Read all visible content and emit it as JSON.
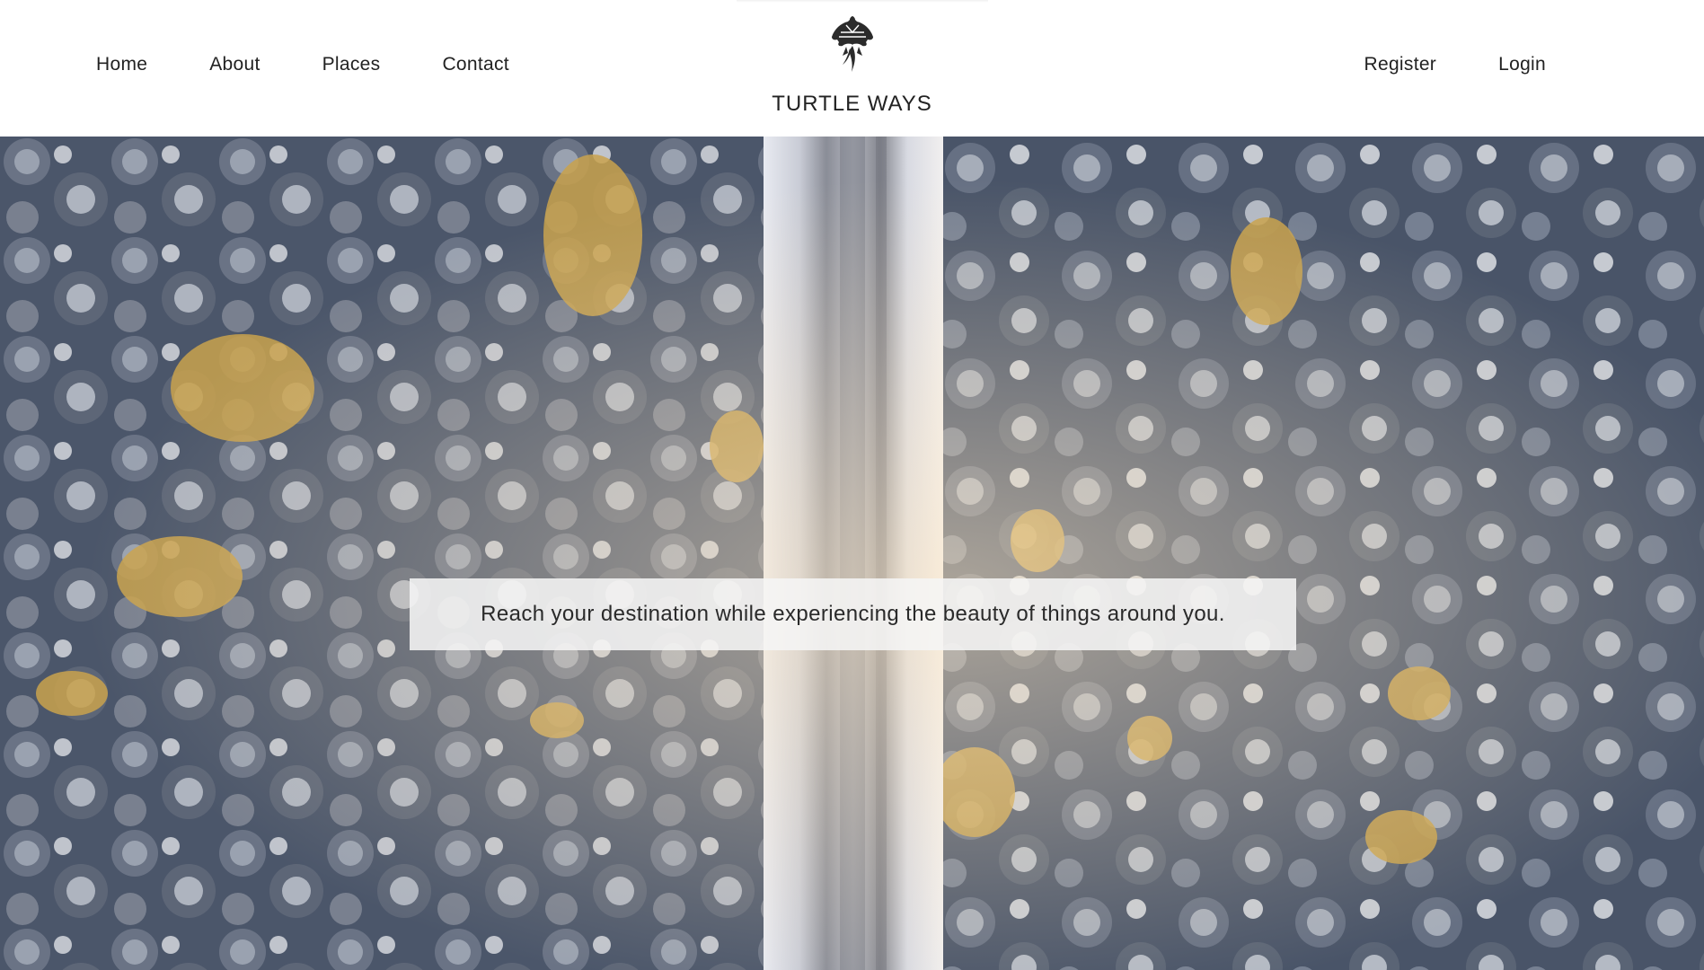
{
  "header": {
    "nav_left": [
      {
        "label": "Home"
      },
      {
        "label": "About"
      },
      {
        "label": "Places"
      },
      {
        "label": "Contact"
      }
    ],
    "nav_right": [
      {
        "label": "Register"
      },
      {
        "label": "Login"
      }
    ],
    "brand": {
      "name": "TURTLE WAYS",
      "logo_icon": "turtle-logo-icon"
    }
  },
  "hero": {
    "tagline": "Reach your destination while experiencing the beauty of things around you.",
    "image_subject": "aerial-snowy-forest-road"
  },
  "colors": {
    "text": "#222222",
    "header_bg": "#ffffff",
    "tagline_bg": "#f5f5f5"
  }
}
